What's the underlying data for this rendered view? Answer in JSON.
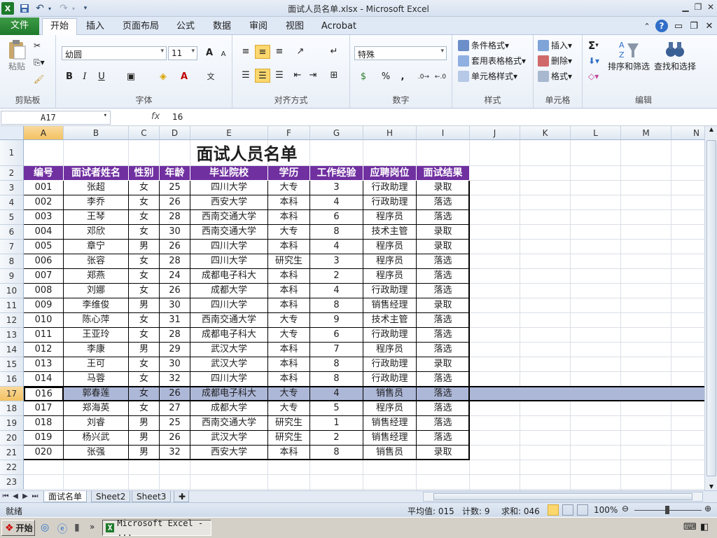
{
  "window": {
    "title": "面试人员名单.xlsx - Microsoft Excel",
    "app_icon": "X"
  },
  "ribbon_tabs": [
    "文件",
    "开始",
    "插入",
    "页面布局",
    "公式",
    "数据",
    "审阅",
    "视图",
    "Acrobat"
  ],
  "ribbon": {
    "clipboard": {
      "paste": "粘贴",
      "group": "剪贴板"
    },
    "font": {
      "name": "幼圆",
      "size": "11",
      "group": "字体",
      "bold": "B",
      "italic": "I",
      "underline": "U",
      "grow": "A",
      "shrink": "A"
    },
    "alignment": {
      "group": "对齐方式"
    },
    "number": {
      "format": "特殊",
      "group": "数字",
      "percent": "%",
      "comma": ","
    },
    "styles": {
      "cond": "条件格式",
      "table": "套用表格格式",
      "cell": "单元格样式",
      "group": "样式"
    },
    "cells": {
      "insert": "插入",
      "delete": "删除",
      "format": "格式",
      "group": "单元格"
    },
    "editing": {
      "sum": "Σ",
      "sort": "排序和筛选",
      "find": "查找和选择",
      "group": "编辑"
    }
  },
  "formula_bar": {
    "name_box": "A17",
    "fx": "fx",
    "value": "16"
  },
  "columns": [
    "A",
    "B",
    "C",
    "D",
    "E",
    "F",
    "G",
    "H",
    "I",
    "J",
    "K",
    "L",
    "M",
    "N"
  ],
  "rows": [
    "1",
    "2",
    "3",
    "4",
    "5",
    "6",
    "7",
    "8",
    "9",
    "10",
    "11",
    "12",
    "13",
    "14",
    "15",
    "16",
    "17",
    "18",
    "19",
    "20",
    "21",
    "22",
    "23"
  ],
  "sheet": {
    "title": "面试人员名单",
    "headers": [
      "编号",
      "面试者姓名",
      "性别",
      "年龄",
      "毕业院校",
      "学历",
      "工作经验",
      "应聘岗位",
      "面试结果"
    ],
    "data": [
      [
        "001",
        "张超",
        "女",
        "25",
        "四川大学",
        "大专",
        "3",
        "行政助理",
        "录取"
      ],
      [
        "002",
        "李乔",
        "女",
        "26",
        "西安大学",
        "本科",
        "4",
        "行政助理",
        "落选"
      ],
      [
        "003",
        "王琴",
        "女",
        "28",
        "西南交通大学",
        "本科",
        "6",
        "程序员",
        "落选"
      ],
      [
        "004",
        "邓欣",
        "女",
        "30",
        "西南交通大学",
        "大专",
        "8",
        "技术主管",
        "录取"
      ],
      [
        "005",
        "章宁",
        "男",
        "26",
        "四川大学",
        "本科",
        "4",
        "程序员",
        "录取"
      ],
      [
        "006",
        "张容",
        "女",
        "28",
        "四川大学",
        "研究生",
        "3",
        "程序员",
        "落选"
      ],
      [
        "007",
        "郑燕",
        "女",
        "24",
        "成都电子科大",
        "本科",
        "2",
        "程序员",
        "落选"
      ],
      [
        "008",
        "刘娜",
        "女",
        "26",
        "成都大学",
        "本科",
        "4",
        "行政助理",
        "落选"
      ],
      [
        "009",
        "李维俊",
        "男",
        "30",
        "四川大学",
        "本科",
        "8",
        "销售经理",
        "录取"
      ],
      [
        "010",
        "陈心萍",
        "女",
        "31",
        "西南交通大学",
        "大专",
        "9",
        "技术主管",
        "落选"
      ],
      [
        "011",
        "王亚玲",
        "女",
        "28",
        "成都电子科大",
        "大专",
        "6",
        "行政助理",
        "落选"
      ],
      [
        "012",
        "李康",
        "男",
        "29",
        "武汉大学",
        "本科",
        "7",
        "程序员",
        "落选"
      ],
      [
        "013",
        "王可",
        "女",
        "30",
        "武汉大学",
        "本科",
        "8",
        "行政助理",
        "录取"
      ],
      [
        "014",
        "马蓉",
        "女",
        "32",
        "四川大学",
        "本科",
        "8",
        "行政助理",
        "落选"
      ],
      [
        "016",
        "郭春莲",
        "女",
        "26",
        "成都电子科大",
        "大专",
        "4",
        "销售员",
        "落选"
      ],
      [
        "017",
        "郑海英",
        "女",
        "27",
        "成都大学",
        "大专",
        "5",
        "程序员",
        "落选"
      ],
      [
        "018",
        "刘睿",
        "男",
        "25",
        "西南交通大学",
        "研究生",
        "1",
        "销售经理",
        "落选"
      ],
      [
        "019",
        "杨兴武",
        "男",
        "26",
        "武汉大学",
        "研究生",
        "2",
        "销售经理",
        "落选"
      ],
      [
        "020",
        "张强",
        "男",
        "32",
        "西安大学",
        "本科",
        "8",
        "销售员",
        "录取"
      ]
    ]
  },
  "sheet_tabs": [
    "面试名单",
    "Sheet2",
    "Sheet3"
  ],
  "status": {
    "ready": "就绪",
    "average": "平均值: 015",
    "count": "计数: 9",
    "sum": "求和: 046",
    "zoom": "100%"
  },
  "taskbar": {
    "start": "开始",
    "excel": "Microsoft Excel - ..."
  },
  "colors": {
    "header_purple": "#7030a0",
    "selected_row": "#adb8d8",
    "file_tab": "#1e7a2b"
  }
}
